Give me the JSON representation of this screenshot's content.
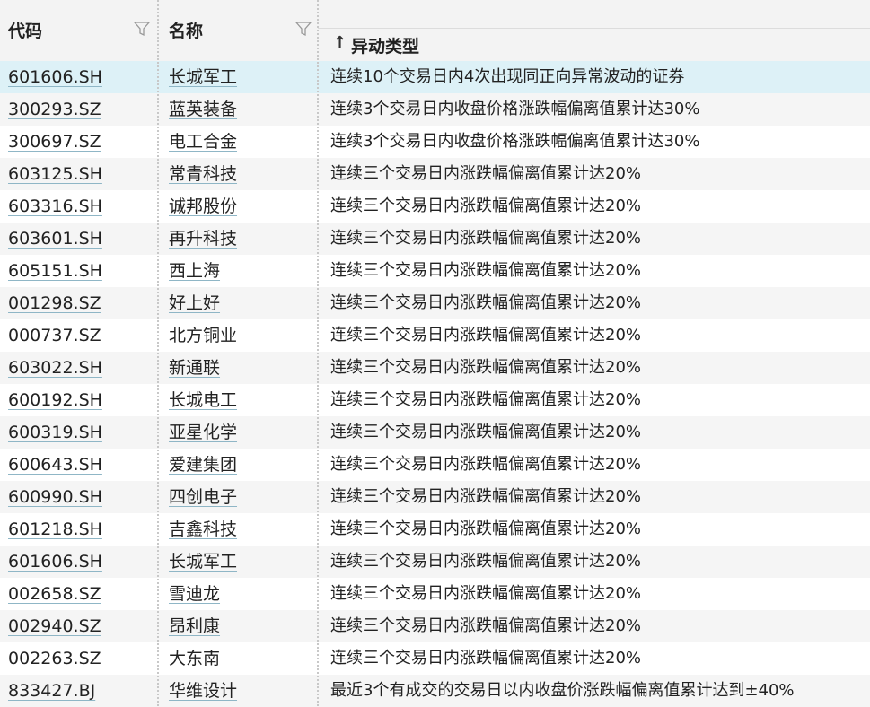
{
  "columns": {
    "code": "代码",
    "name": "名称",
    "type": "异动类型",
    "type_sort_icon": "↑"
  },
  "icons": {
    "filter": "filter-icon",
    "sort": "sort-up-icon"
  },
  "colors": {
    "selected_row": "#ddf1f7",
    "header_bg": "#f3f3f3",
    "stripe": "#f5f5f5"
  },
  "rows": [
    {
      "code": "601606.SH",
      "name": "长城军工",
      "type": "连续10个交易日内4次出现同正向异常波动的证券"
    },
    {
      "code": "300293.SZ",
      "name": "蓝英装备",
      "type": "连续3个交易日内收盘价格涨跌幅偏离值累计达30%"
    },
    {
      "code": "300697.SZ",
      "name": "电工合金",
      "type": "连续3个交易日内收盘价格涨跌幅偏离值累计达30%"
    },
    {
      "code": "603125.SH",
      "name": "常青科技",
      "type": "连续三个交易日内涨跌幅偏离值累计达20%"
    },
    {
      "code": "603316.SH",
      "name": "诚邦股份",
      "type": "连续三个交易日内涨跌幅偏离值累计达20%"
    },
    {
      "code": "603601.SH",
      "name": "再升科技",
      "type": "连续三个交易日内涨跌幅偏离值累计达20%"
    },
    {
      "code": "605151.SH",
      "name": "西上海",
      "type": "连续三个交易日内涨跌幅偏离值累计达20%"
    },
    {
      "code": "001298.SZ",
      "name": "好上好",
      "type": "连续三个交易日内涨跌幅偏离值累计达20%"
    },
    {
      "code": "000737.SZ",
      "name": "北方铜业",
      "type": "连续三个交易日内涨跌幅偏离值累计达20%"
    },
    {
      "code": "603022.SH",
      "name": "新通联",
      "type": "连续三个交易日内涨跌幅偏离值累计达20%"
    },
    {
      "code": "600192.SH",
      "name": "长城电工",
      "type": "连续三个交易日内涨跌幅偏离值累计达20%"
    },
    {
      "code": "600319.SH",
      "name": "亚星化学",
      "type": "连续三个交易日内涨跌幅偏离值累计达20%"
    },
    {
      "code": "600643.SH",
      "name": "爱建集团",
      "type": "连续三个交易日内涨跌幅偏离值累计达20%"
    },
    {
      "code": "600990.SH",
      "name": "四创电子",
      "type": "连续三个交易日内涨跌幅偏离值累计达20%"
    },
    {
      "code": "601218.SH",
      "name": "吉鑫科技",
      "type": "连续三个交易日内涨跌幅偏离值累计达20%"
    },
    {
      "code": "601606.SH",
      "name": "长城军工",
      "type": "连续三个交易日内涨跌幅偏离值累计达20%"
    },
    {
      "code": "002658.SZ",
      "name": "雪迪龙",
      "type": "连续三个交易日内涨跌幅偏离值累计达20%"
    },
    {
      "code": "002940.SZ",
      "name": "昂利康",
      "type": "连续三个交易日内涨跌幅偏离值累计达20%"
    },
    {
      "code": "002263.SZ",
      "name": "大东南",
      "type": "连续三个交易日内涨跌幅偏离值累计达20%"
    },
    {
      "code": "833427.BJ",
      "name": "华维设计",
      "type": "最近3个有成交的交易日以内收盘价涨跌幅偏离值累计达到±40%"
    }
  ]
}
